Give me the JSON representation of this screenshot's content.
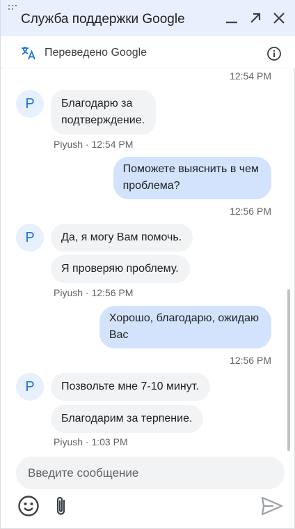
{
  "header": {
    "title": "Служба поддержки Google"
  },
  "translate_bar": {
    "text": "Переведено Google"
  },
  "messages": {
    "ts_top": "12:54 PM",
    "g1": {
      "m1": "Благодарю за\nподтверждение.",
      "sender": "Piyush · 12:54 PM",
      "avatar": "P"
    },
    "u1": {
      "text": "Поможете выяснить в чем\nпроблема?",
      "time": "12:56 PM"
    },
    "g2": {
      "m1": "Да, я могу Вам помочь.",
      "m2": "Я проверяю проблему.",
      "sender": "Piyush · 12:56 PM",
      "avatar": "P"
    },
    "u2": {
      "text": "Хорошо, благодарю, ожидаю\nВас",
      "time": "12:56 PM"
    },
    "g3": {
      "m1": "Позвольте мне 7-10 минут.",
      "m2": "Благодарим за терпение.",
      "sender": "Piyush · 1:03 PM",
      "avatar": "P"
    }
  },
  "composer": {
    "placeholder": "Введите сообщение"
  },
  "icons": {
    "drag": "drag-handle-icon",
    "minimize": "minimize-icon",
    "popout": "open-in-new-icon",
    "close": "close-icon",
    "translate": "translate-icon",
    "info": "info-icon",
    "emoji": "emoji-icon",
    "attach": "attach-icon",
    "send": "send-icon"
  },
  "colors": {
    "header_bg": "#e8f0fe",
    "user_bubble": "#d3e3fd",
    "agent_bubble": "#f1f3f4",
    "avatar_text": "#1a73e8"
  }
}
